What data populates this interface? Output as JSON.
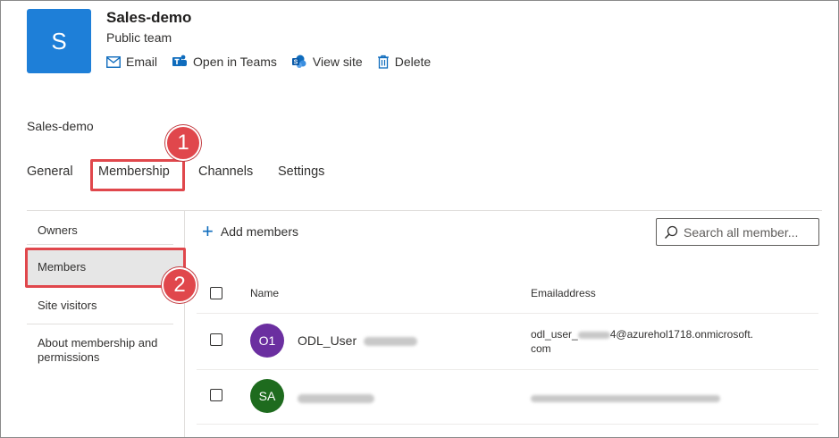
{
  "team": {
    "initial": "S",
    "name": "Sales-demo",
    "type": "Public team",
    "tile_color": "#1e7fd8"
  },
  "actions": [
    {
      "label": "Email",
      "icon": "mail-icon"
    },
    {
      "label": "Open in Teams",
      "icon": "teams-icon"
    },
    {
      "label": "View site",
      "icon": "sharepoint-icon"
    },
    {
      "label": "Delete",
      "icon": "trash-icon"
    }
  ],
  "breadcrumb": "Sales-demo",
  "tabs": [
    {
      "label": "General"
    },
    {
      "label": "Membership",
      "selected": true
    },
    {
      "label": "Channels"
    },
    {
      "label": "Settings"
    }
  ],
  "callouts": {
    "one": "1",
    "two": "2",
    "color": "#e0474c"
  },
  "left_nav": [
    {
      "label": "Owners"
    },
    {
      "label": "Members",
      "selected": true
    },
    {
      "label": "Site visitors"
    },
    {
      "label": "About membership and permissions"
    }
  ],
  "toolbar": {
    "add_members": "Add members",
    "search_placeholder": "Search all member..."
  },
  "table": {
    "columns": [
      "Name",
      "Emailaddress"
    ],
    "rows": [
      {
        "initials": "O1",
        "avatar_color": "#6b2fa0",
        "name": "ODL_User",
        "email_line1": "odl_user_",
        "email_line1b": "4@azurehol1718.onmicrosoft.",
        "email_line2": "com"
      },
      {
        "initials": "SA",
        "avatar_color": "#1e6b1e",
        "name": "",
        "email_line1": "",
        "email_line1b": "",
        "email_line2": ""
      }
    ]
  }
}
